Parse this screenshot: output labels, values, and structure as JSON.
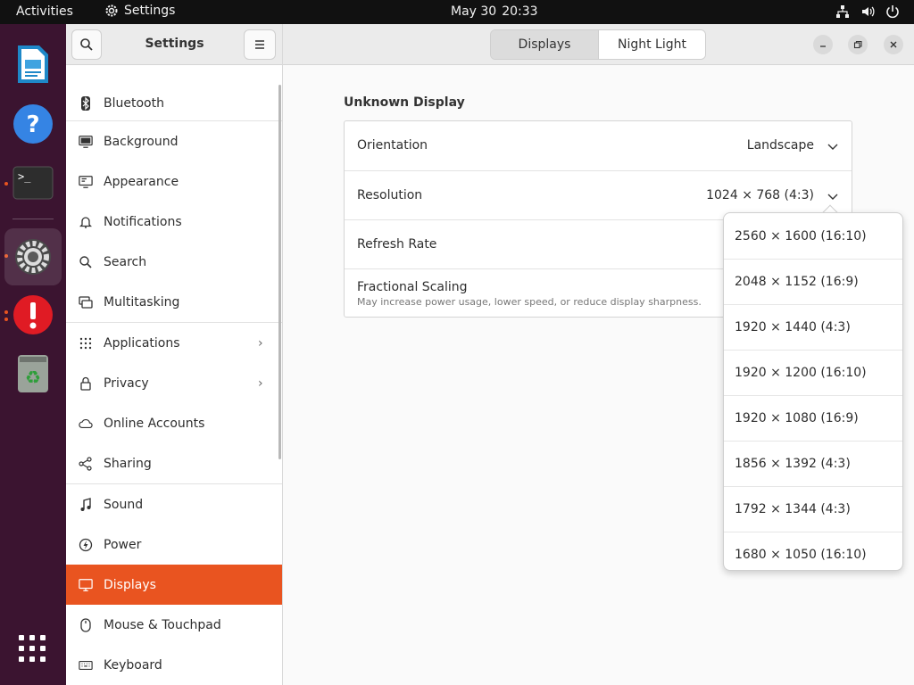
{
  "topbar": {
    "activities": "Activities",
    "app_name": "Settings",
    "date": "May 30",
    "time": "20:33",
    "status_icons": [
      "network-icon",
      "volume-icon",
      "power-icon"
    ]
  },
  "dock": {
    "items": [
      {
        "name": "libreoffice-writer-icon",
        "running": false
      },
      {
        "name": "help-icon",
        "running": false
      },
      {
        "name": "terminal-icon",
        "running": true
      },
      {
        "name": "settings-icon",
        "running": true,
        "active": true
      },
      {
        "name": "software-updater-icon",
        "running": true
      },
      {
        "name": "trash-icon",
        "running": false
      }
    ],
    "apps_grid": "show-applications-icon"
  },
  "sidebar": {
    "title": "Settings",
    "items": [
      {
        "label": "Bluetooth",
        "icon": "bluetooth-icon"
      },
      {
        "label": "Background",
        "icon": "background-icon"
      },
      {
        "label": "Appearance",
        "icon": "appearance-icon"
      },
      {
        "label": "Notifications",
        "icon": "bell-icon"
      },
      {
        "label": "Search",
        "icon": "search-icon"
      },
      {
        "label": "Multitasking",
        "icon": "multitasking-icon"
      },
      {
        "label": "Applications",
        "icon": "apps-icon",
        "chevron": "›"
      },
      {
        "label": "Privacy",
        "icon": "lock-icon",
        "chevron": "›"
      },
      {
        "label": "Online Accounts",
        "icon": "cloud-icon"
      },
      {
        "label": "Sharing",
        "icon": "share-icon"
      },
      {
        "label": "Sound",
        "icon": "music-note-icon"
      },
      {
        "label": "Power",
        "icon": "power-icon"
      },
      {
        "label": "Displays",
        "icon": "display-icon",
        "selected": true
      },
      {
        "label": "Mouse & Touchpad",
        "icon": "mouse-icon"
      },
      {
        "label": "Keyboard",
        "icon": "keyboard-icon"
      }
    ]
  },
  "header": {
    "tabs": [
      {
        "label": "Displays",
        "active": true
      },
      {
        "label": "Night Light",
        "active": false
      }
    ]
  },
  "main": {
    "section_title": "Unknown Display",
    "rows": {
      "orientation": {
        "label": "Orientation",
        "value": "Landscape"
      },
      "resolution": {
        "label": "Resolution",
        "value": "1024 × 768 (4:3)"
      },
      "refresh": {
        "label": "Refresh Rate"
      },
      "scaling": {
        "label": "Fractional Scaling",
        "sub": "May increase power usage, lower speed, or reduce display sharpness."
      }
    }
  },
  "resolution_popover": {
    "options": [
      "2560 × 1600 (16:10)",
      "2048 × 1152 (16:9)",
      "1920 × 1440 (4:3)",
      "1920 × 1200 (16:10)",
      "1920 × 1080 (16:9)",
      "1856 × 1392 (4:3)",
      "1792 × 1344 (4:3)",
      "1680 × 1050 (16:10)"
    ]
  },
  "colors": {
    "accent": "#e95420",
    "dock_bg": "#3b1430",
    "topbar_bg": "#111111"
  }
}
